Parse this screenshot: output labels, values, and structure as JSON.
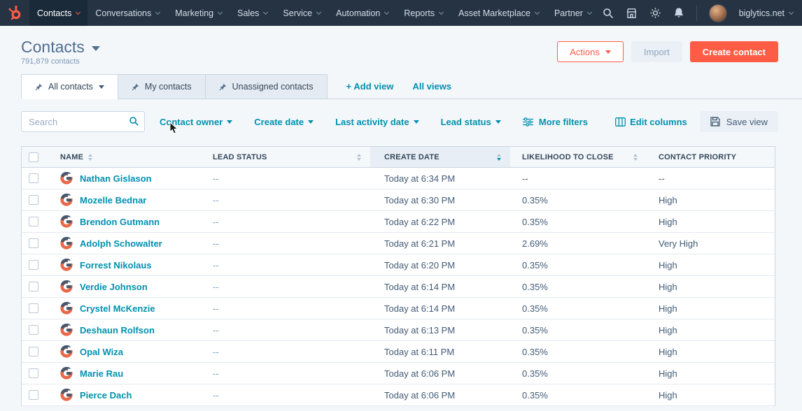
{
  "nav": {
    "items": [
      {
        "label": "Contacts",
        "active": true
      },
      {
        "label": "Conversations"
      },
      {
        "label": "Marketing"
      },
      {
        "label": "Sales"
      },
      {
        "label": "Service"
      },
      {
        "label": "Automation"
      },
      {
        "label": "Reports"
      },
      {
        "label": "Asset Marketplace"
      },
      {
        "label": "Partner"
      }
    ],
    "account_name": "biglytics.net",
    "icon_names": [
      "search-icon",
      "marketplace-icon",
      "settings-icon",
      "notifications-icon"
    ]
  },
  "header": {
    "title": "Contacts",
    "contact_count": "791,879 contacts",
    "actions_button": "Actions",
    "import_button": "Import",
    "create_button": "Create contact"
  },
  "tabs": {
    "items": [
      {
        "label": "All contacts",
        "active": true,
        "pinned": true
      },
      {
        "label": "My contacts",
        "pinned": true
      },
      {
        "label": "Unassigned contacts",
        "pinned": true
      }
    ],
    "add_view_label": "+ Add view",
    "all_views_label": "All views"
  },
  "filters": {
    "search_placeholder": "Search",
    "dropdowns": [
      {
        "label": "Contact owner"
      },
      {
        "label": "Create date"
      },
      {
        "label": "Last activity date"
      },
      {
        "label": "Lead status"
      }
    ],
    "more_filters_label": "More filters",
    "edit_columns_label": "Edit columns",
    "save_view_label": "Save view"
  },
  "table": {
    "columns": [
      {
        "label": "NAME",
        "sortable": true
      },
      {
        "label": "LEAD STATUS",
        "sortable": true
      },
      {
        "label": "CREATE DATE",
        "sortable": true,
        "sorted": "desc"
      },
      {
        "label": "LIKELIHOOD TO CLOSE",
        "sortable": true
      },
      {
        "label": "CONTACT PRIORITY",
        "sortable": false
      }
    ],
    "rows": [
      {
        "name": "Nathan Gislason",
        "lead_status": "--",
        "create_date": "Today at 6:34 PM",
        "likelihood_to_close": "--",
        "contact_priority": "--"
      },
      {
        "name": "Mozelle Bednar",
        "lead_status": "--",
        "create_date": "Today at 6:30 PM",
        "likelihood_to_close": "0.35%",
        "contact_priority": "High"
      },
      {
        "name": "Brendon Gutmann",
        "lead_status": "--",
        "create_date": "Today at 6:22 PM",
        "likelihood_to_close": "0.35%",
        "contact_priority": "High"
      },
      {
        "name": "Adolph Schowalter",
        "lead_status": "--",
        "create_date": "Today at 6:21 PM",
        "likelihood_to_close": "2.69%",
        "contact_priority": "Very High"
      },
      {
        "name": "Forrest Nikolaus",
        "lead_status": "--",
        "create_date": "Today at 6:20 PM",
        "likelihood_to_close": "0.35%",
        "contact_priority": "High"
      },
      {
        "name": "Verdie Johnson",
        "lead_status": "--",
        "create_date": "Today at 6:14 PM",
        "likelihood_to_close": "0.35%",
        "contact_priority": "High"
      },
      {
        "name": "Crystel McKenzie",
        "lead_status": "--",
        "create_date": "Today at 6:14 PM",
        "likelihood_to_close": "0.35%",
        "contact_priority": "High"
      },
      {
        "name": "Deshaun Rolfson",
        "lead_status": "--",
        "create_date": "Today at 6:13 PM",
        "likelihood_to_close": "0.35%",
        "contact_priority": "High"
      },
      {
        "name": "Opal Wiza",
        "lead_status": "--",
        "create_date": "Today at 6:11 PM",
        "likelihood_to_close": "0.35%",
        "contact_priority": "High"
      },
      {
        "name": "Marie Rau",
        "lead_status": "--",
        "create_date": "Today at 6:06 PM",
        "likelihood_to_close": "0.35%",
        "contact_priority": "High"
      },
      {
        "name": "Pierce Dach",
        "lead_status": "--",
        "create_date": "Today at 6:06 PM",
        "likelihood_to_close": "0.35%",
        "contact_priority": "High"
      }
    ]
  },
  "colors": {
    "nav_bg": "#253342",
    "accent_orange": "#ff5c45",
    "link_teal": "#0091ae",
    "page_bg": "#f4f7fa",
    "text_dark": "#33475b",
    "text_muted": "#7c98b6"
  }
}
